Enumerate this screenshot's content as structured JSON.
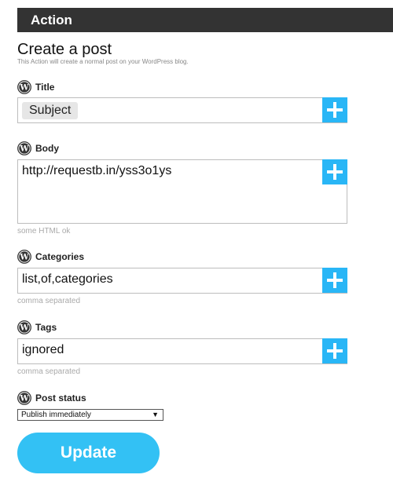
{
  "header": {
    "title": "Action"
  },
  "page": {
    "title": "Create a post",
    "subtitle": "This Action will create a normal post on your WordPress blog."
  },
  "fields": {
    "title": {
      "label": "Title",
      "token": "Subject",
      "icon": "wordpress-icon",
      "add_icon": "plus-icon"
    },
    "body": {
      "label": "Body",
      "value": "http://requestb.in/yss3o1ys",
      "hint": "some HTML ok",
      "icon": "wordpress-icon",
      "add_icon": "plus-icon"
    },
    "categories": {
      "label": "Categories",
      "value": "list,of,categories",
      "hint": "comma separated",
      "icon": "wordpress-icon",
      "add_icon": "plus-icon"
    },
    "tags": {
      "label": "Tags",
      "value": "ignored",
      "hint": "comma separated",
      "icon": "wordpress-icon",
      "add_icon": "plus-icon"
    },
    "post_status": {
      "label": "Post status",
      "selected": "Publish immediately",
      "arrow": "▼",
      "icon": "wordpress-icon"
    }
  },
  "actions": {
    "update_label": "Update"
  },
  "colors": {
    "header_bg": "#333333",
    "accent": "#29b6f6",
    "button": "#33c1f4"
  }
}
